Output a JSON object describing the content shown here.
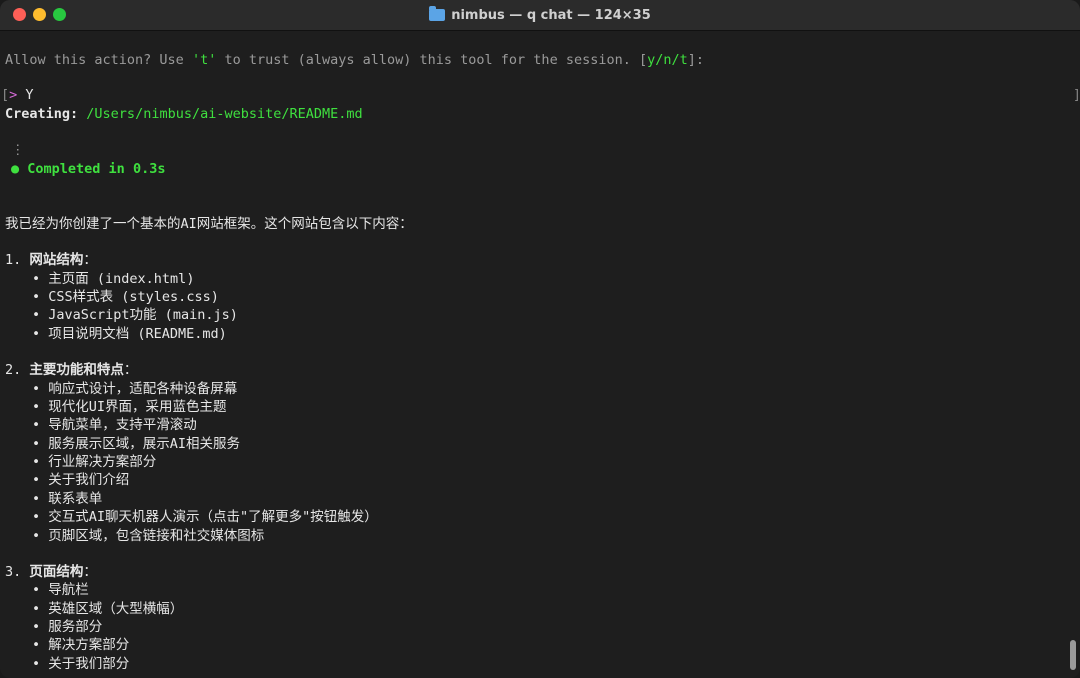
{
  "window": {
    "title": "nimbus — q chat — 124×35"
  },
  "prompt": {
    "question": "Allow this action? Use ",
    "trust_key": "'t'",
    "question_rest": " to trust (always allow) this tool for the session. [",
    "options": "y/n/t",
    "question_end": "]:"
  },
  "input": {
    "caret": ">",
    "value": "Y"
  },
  "creating": {
    "label": "Creating:",
    "path": "/Users/nimbus/ai-website/README.md"
  },
  "status": {
    "dots": "⋮",
    "bullet": "●",
    "text": "Completed in 0.3s"
  },
  "summary": "我已经为你创建了一个基本的AI网站框架。这个网站包含以下内容：",
  "sections": [
    {
      "num": "1.",
      "title": "网站结构",
      "colon": "：",
      "items": [
        "主页面 (index.html)",
        "CSS样式表 (styles.css)",
        "JavaScript功能 (main.js)",
        "项目说明文档 (README.md)"
      ]
    },
    {
      "num": "2.",
      "title": "主要功能和特点",
      "colon": "：",
      "items": [
        "响应式设计，适配各种设备屏幕",
        "现代化UI界面，采用蓝色主题",
        "导航菜单，支持平滑滚动",
        "服务展示区域，展示AI相关服务",
        "行业解决方案部分",
        "关于我们介绍",
        "联系表单",
        "交互式AI聊天机器人演示（点击\"了解更多\"按钮触发）",
        "页脚区域，包含链接和社交媒体图标"
      ]
    },
    {
      "num": "3.",
      "title": "页面结构",
      "colon": "：",
      "items": [
        "导航栏",
        "英雄区域（大型横幅）",
        "服务部分",
        "解决方案部分",
        "关于我们部分"
      ]
    }
  ],
  "bullet_char": "•",
  "colors": {
    "background": "#1e1e1e",
    "green": "#3fe03f",
    "magenta": "#d36ad6"
  }
}
